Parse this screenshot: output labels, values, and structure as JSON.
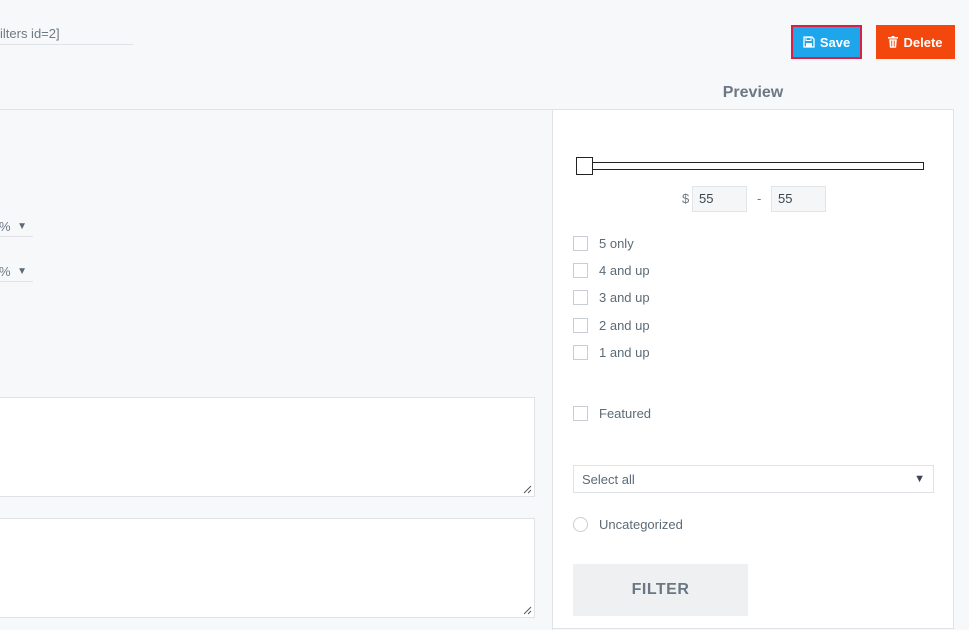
{
  "header": {
    "shortcode": "ilters id=2]",
    "save_label": "Save",
    "delete_label": "Delete",
    "colors": {
      "save": "#1ea6ec",
      "save_border": "#d72043",
      "delete": "#f3470d"
    }
  },
  "settings": {
    "selects": [
      {
        "value": "%"
      },
      {
        "value": "%"
      }
    ]
  },
  "preview": {
    "title": "Preview",
    "price": {
      "currency": "$",
      "separator": "-",
      "min": "55",
      "max": "55"
    },
    "ratings": [
      {
        "label": "5 only"
      },
      {
        "label": "4 and up"
      },
      {
        "label": "3 and up"
      },
      {
        "label": "2 and up"
      },
      {
        "label": "1 and up"
      }
    ],
    "featured_label": "Featured",
    "category_select": "Select all",
    "category_option": "Uncategorized",
    "filter_button": "FILTER"
  }
}
